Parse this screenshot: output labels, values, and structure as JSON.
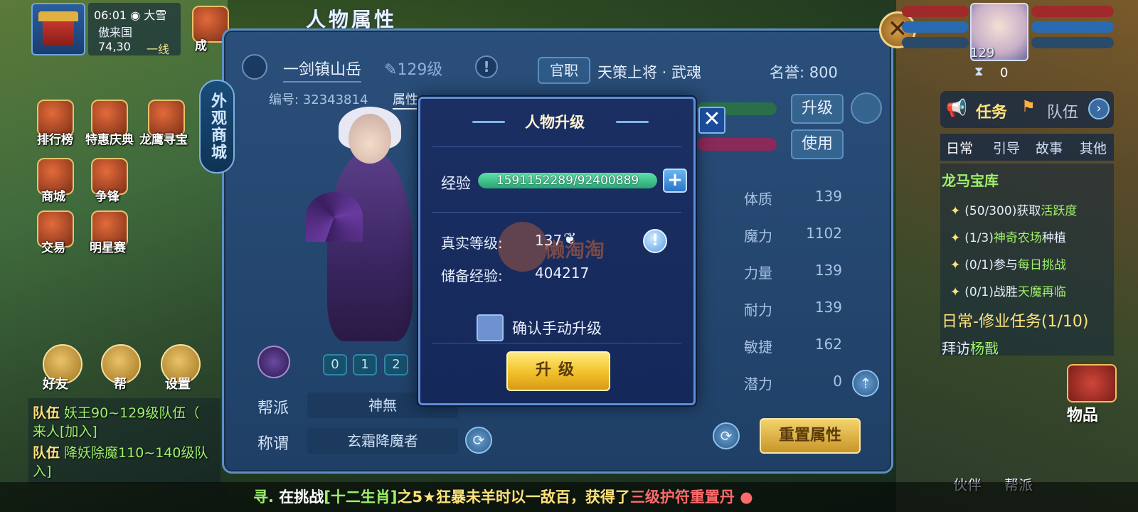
{
  "status": {
    "time": "06:01",
    "weather": "大雪",
    "server": "傲来国",
    "coords": "74,30",
    "line": "一线"
  },
  "left_icons": {
    "success": "成",
    "ranking": "排行榜",
    "special_celebration": "特惠庆典",
    "dragon_treasure": "龙鹰寻宝",
    "shop": "商城",
    "compete": "争锋",
    "trade": "交易",
    "star_match": "明星赛",
    "friends": "好友",
    "help": "帮",
    "settings": "设置",
    "vertical_shop": "外观商城"
  },
  "panel": {
    "title": "人物属性",
    "character_name": "一剑镇山岳",
    "level": "129级",
    "id_label": "编号: 32343814",
    "attr_tab": "属性",
    "official_btn": "官职",
    "official_title": "天策上将 · 武魂",
    "fame": "名誉: 800",
    "upgrade_btn": "升级",
    "use_btn": "使用",
    "stats": [
      {
        "label": "体质",
        "value": "139"
      },
      {
        "label": "魔力",
        "value": "1102"
      },
      {
        "label": "力量",
        "value": "139"
      },
      {
        "label": "耐力",
        "value": "139"
      },
      {
        "label": "敏捷",
        "value": "162"
      },
      {
        "label": "潜力",
        "value": "0"
      }
    ],
    "slots": [
      "0",
      "1",
      "2"
    ],
    "gang_label": "帮派",
    "gang_value": "神無",
    "title_label": "称谓",
    "title_value": "玄霜降魔者",
    "reset_btn": "重置属性"
  },
  "modal": {
    "title": "人物升级",
    "exp_label": "经验",
    "exp_text": "1591152289/92400889",
    "exp_progress": 1.0,
    "real_level_label": "真实等级:",
    "real_level_value": "137",
    "reserve_exp_label": "储备经验:",
    "reserve_exp_value": "404217",
    "confirm_label": "确认手动升级",
    "upgrade_btn": "升级",
    "close": "✕",
    "watermark": "懒淘淘"
  },
  "right": {
    "portrait_level": "129",
    "portrait_zero": "0",
    "tab_task": "任务",
    "tab_team": "队伍",
    "sub_tabs": [
      "日常",
      "引导",
      "故事",
      "其他"
    ],
    "task_group_title": "龙马宝库",
    "tasks": [
      {
        "count": "(50/300)",
        "pre": "获取",
        "hl": "活跃度",
        "post": ""
      },
      {
        "count": "(1/3)",
        "pre": "",
        "hl": "神奇农场",
        "post": "种植"
      },
      {
        "count": "(0/1)",
        "pre": "参与",
        "hl": "每日挑战",
        "post": ""
      },
      {
        "count": "(0/1)",
        "pre": "战胜",
        "hl": "天魔再临",
        "post": ""
      }
    ],
    "daily_task_title": "日常-修业任务(1/10)",
    "daily_task_sub_pre": "拜访",
    "daily_task_sub_hl": "杨戬",
    "items_btn": "物品",
    "partner_btn": "伙伴",
    "gang_btn": "帮派"
  },
  "chat": [
    {
      "tag": "队伍",
      "msg": "妖王90~129级队伍（"
    },
    {
      "tag": "",
      "msg": "来人[加入]"
    },
    {
      "tag": "队伍",
      "msg": "降妖除魔110~140级队"
    },
    {
      "tag": "",
      "msg": "入]"
    }
  ],
  "marquee": {
    "p1": "寻. ",
    "p2": "在挑战",
    "p3": "[十二生肖]",
    "p4": "之5★狂暴未羊时以一敌百，获得了",
    "p5": "三级护符重置丹"
  },
  "colors": {
    "panel_bg": "#1f3f66",
    "modal_bg": "#15285a",
    "gold_button": "#f1c02a",
    "exp_green": "#2aa474",
    "highlight_green": "#9ef06a",
    "highlight_yellow": "#ffe27a"
  }
}
